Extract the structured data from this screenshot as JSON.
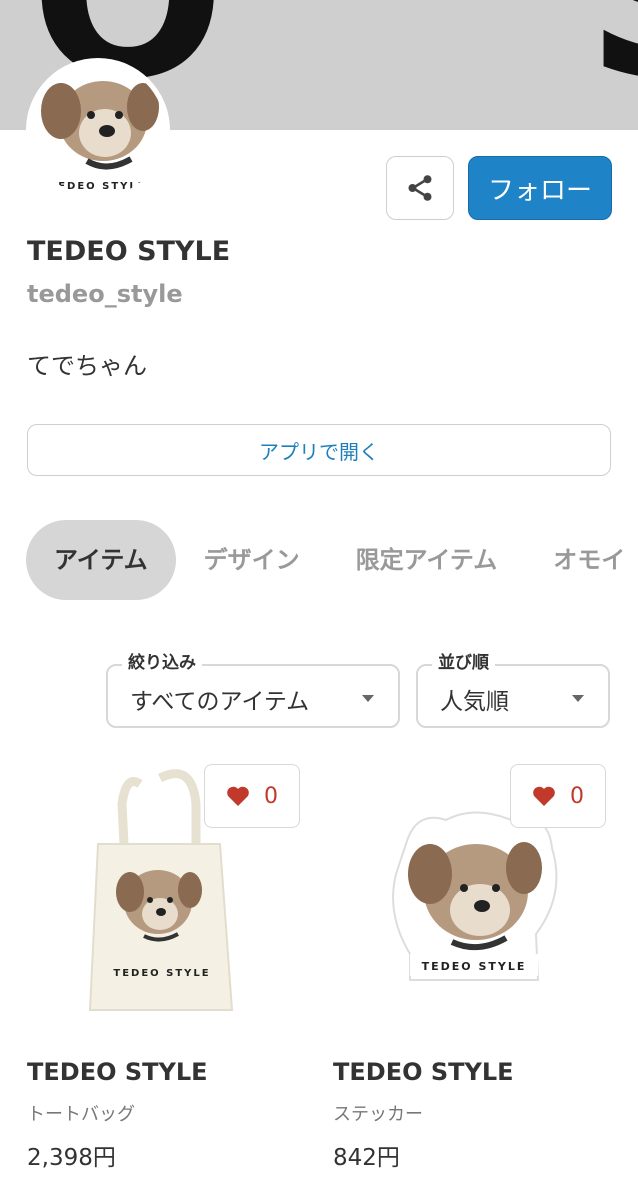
{
  "banner": {
    "text": "O S"
  },
  "avatar": {
    "caption": "TEDEO STYLE"
  },
  "header": {
    "follow_label": "フォロー"
  },
  "profile": {
    "name": "TEDEO STYLE",
    "handle": "tedeo_style",
    "bio": "てでちゃん"
  },
  "open_app_label": "アプリで開く",
  "tabs": [
    {
      "label": "アイテム"
    },
    {
      "label": "デザイン"
    },
    {
      "label": "限定アイテム"
    },
    {
      "label": "オモイ"
    }
  ],
  "filters": {
    "filter": {
      "label": "絞り込み",
      "value": "すべてのアイテム"
    },
    "sort": {
      "label": "並び順",
      "value": "人気順"
    }
  },
  "items": [
    {
      "name": "TEDEO STYLE",
      "type": "トートバッグ",
      "price": "2,398円",
      "likes": "0",
      "print_text": "TEDEO STYLE"
    },
    {
      "name": "TEDEO STYLE",
      "type": "ステッカー",
      "price": "842円",
      "likes": "0",
      "print_text": "TEDEO STYLE"
    }
  ],
  "colors": {
    "accent": "#1f83c8",
    "heart": "#c0392b",
    "banner_bg": "#cfcfcf"
  }
}
